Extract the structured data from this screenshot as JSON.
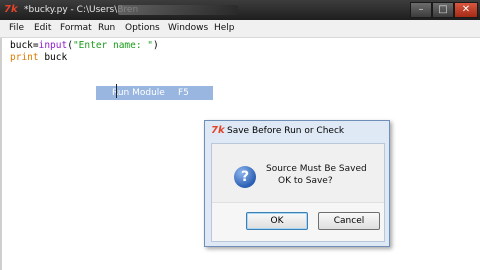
{
  "window": {
    "title": "*bucky.py - C:\\Users\\Bren",
    "controls": {
      "minimize": "–",
      "maximize": "□",
      "close": "✕"
    }
  },
  "menu": [
    "File",
    "Edit",
    "Format",
    "Run",
    "Options",
    "Windows",
    "Help"
  ],
  "code": {
    "line1": {
      "var": "buck=",
      "fn": "input",
      "open": "(",
      "str": "\"Enter name: \"",
      "close": ")"
    },
    "line2": {
      "kw": "print",
      "rest": " buck"
    }
  },
  "run_menu_item": {
    "label": "Run Module",
    "shortcut": "F5"
  },
  "dialog": {
    "title": "Save Before Run or Check",
    "message_line1": "Source Must Be Saved",
    "message_line2": "OK to Save?",
    "ok_label": "OK",
    "cancel_label": "Cancel"
  },
  "icons": {
    "app": "python-idle-icon",
    "question": "question-icon"
  }
}
